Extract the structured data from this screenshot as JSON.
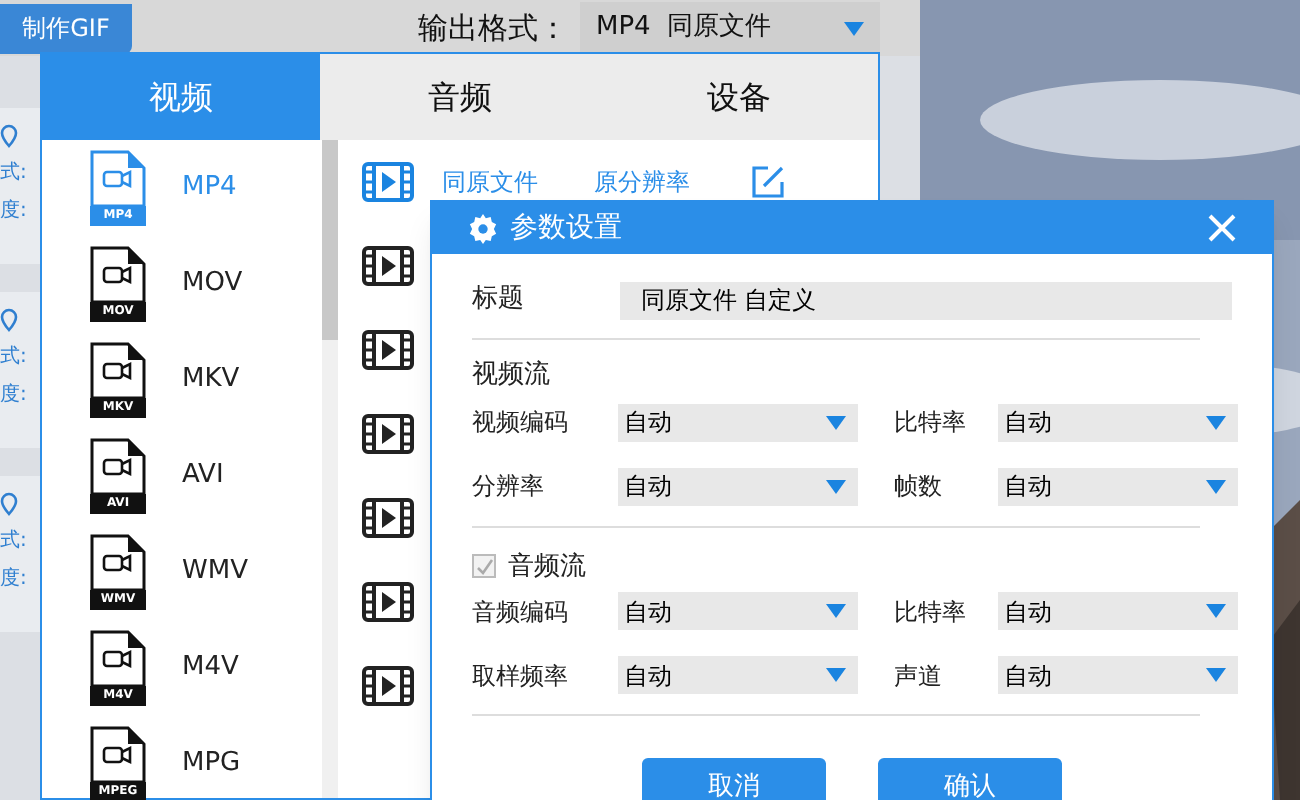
{
  "toolbar": {
    "gif_button": "制作GIF",
    "output_label": "输出格式：",
    "output_value": "MP4  同原文件"
  },
  "background_items": [
    {
      "format": "式:",
      "quality": "度:"
    },
    {
      "format": "式:",
      "quality": "度:"
    },
    {
      "format": "式:",
      "quality": "度:"
    }
  ],
  "tabs": [
    {
      "label": "视频",
      "selected": true
    },
    {
      "label": "音频",
      "selected": false
    },
    {
      "label": "设备",
      "selected": false
    }
  ],
  "formats": [
    {
      "label": "MP4",
      "badge": "MP4",
      "selected": true
    },
    {
      "label": "MOV",
      "badge": "MOV",
      "selected": false
    },
    {
      "label": "MKV",
      "badge": "MKV",
      "selected": false
    },
    {
      "label": "AVI",
      "badge": "AVI",
      "selected": false
    },
    {
      "label": "WMV",
      "badge": "WMV",
      "selected": false
    },
    {
      "label": "M4V",
      "badge": "M4V",
      "selected": false
    },
    {
      "label": "MPG",
      "badge": "MPEG",
      "selected": false
    }
  ],
  "presets": [
    {
      "kind": "labeled",
      "name": "同原文件",
      "resolution": "原分辨率",
      "selected": true
    },
    {
      "kind": "icon_only",
      "selected": false
    },
    {
      "kind": "icon_only",
      "selected": false
    },
    {
      "kind": "icon_only",
      "selected": false
    },
    {
      "kind": "icon_only",
      "selected": false
    },
    {
      "kind": "icon_only",
      "selected": false
    },
    {
      "kind": "icon_only",
      "selected": false
    }
  ],
  "dialog": {
    "title": "参数设置",
    "title_field": {
      "label": "标题",
      "value": "同原文件 自定义"
    },
    "video_section": {
      "heading": "视频流",
      "fields": [
        {
          "label": "视频编码",
          "value": "自动"
        },
        {
          "label": "比特率",
          "value": "自动"
        },
        {
          "label": "分辨率",
          "value": "自动"
        },
        {
          "label": "帧数",
          "value": "自动"
        }
      ]
    },
    "audio_section": {
      "heading": "音频流",
      "checked": true,
      "disabled": true,
      "fields": [
        {
          "label": "音频编码",
          "value": "自动"
        },
        {
          "label": "比特率",
          "value": "自动"
        },
        {
          "label": "取样频率",
          "value": "自动"
        },
        {
          "label": "声道",
          "value": "自动"
        }
      ]
    },
    "buttons": [
      "取消",
      "确认"
    ]
  }
}
